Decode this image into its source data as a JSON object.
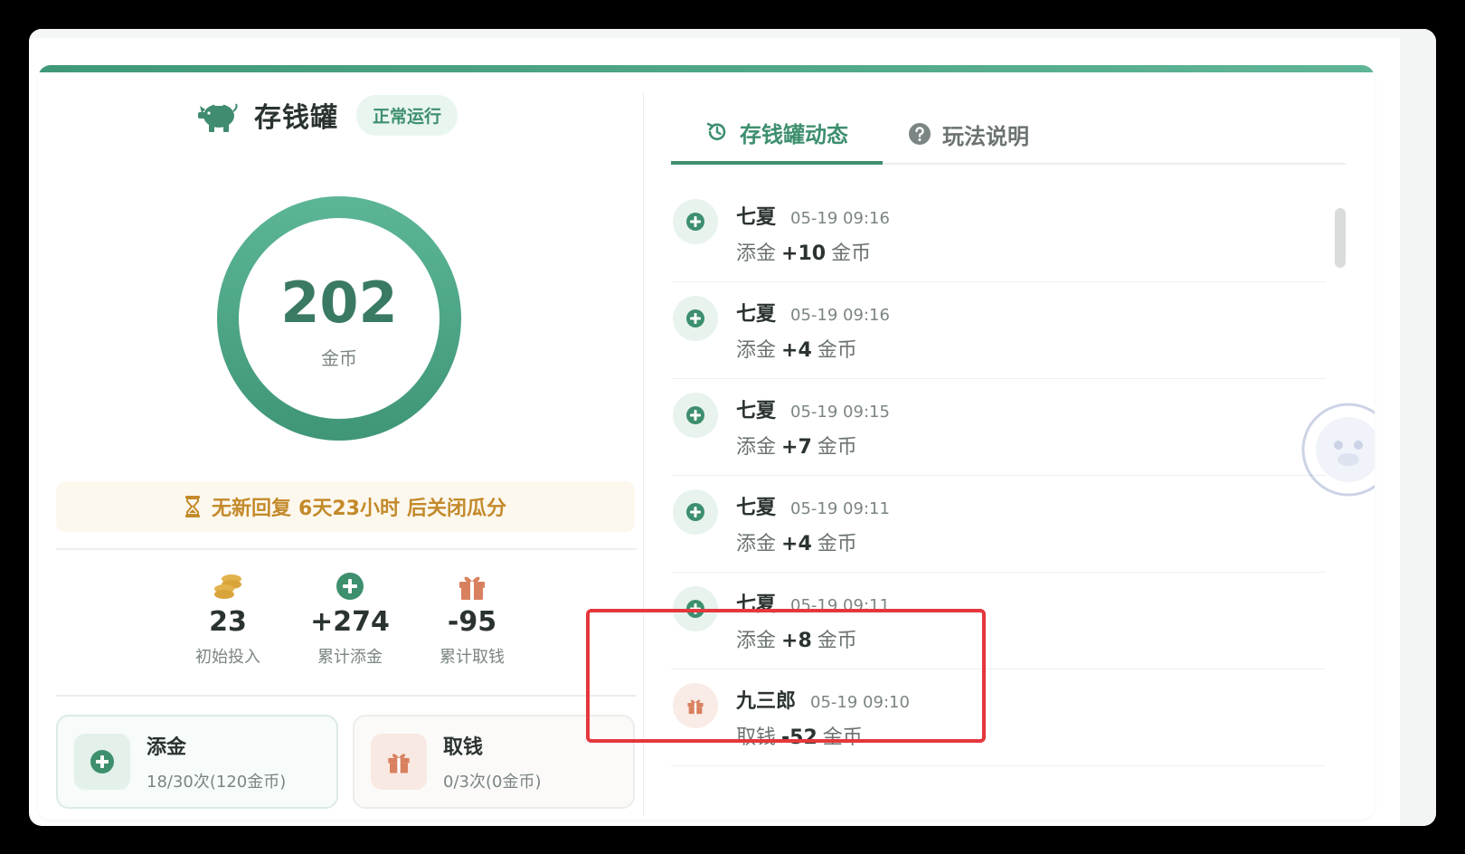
{
  "piggy": {
    "title": "存钱罐",
    "status": "正常运行",
    "balance": "202",
    "unit": "金币",
    "notice": {
      "prefix": "无新回复",
      "remaining": "6天23小时",
      "suffix": "后关闭瓜分"
    },
    "stats": [
      {
        "value": "23",
        "label": "初始投入",
        "icon": "coins-icon"
      },
      {
        "value": "+274",
        "label": "累计添金",
        "icon": "plus-circle-icon"
      },
      {
        "value": "-95",
        "label": "累计取钱",
        "icon": "gift-icon"
      }
    ],
    "actions": {
      "add": {
        "title": "添金",
        "sub": "18/30次(120金币)"
      },
      "take": {
        "title": "取钱",
        "sub": "0/3次(0金币)"
      }
    }
  },
  "tabs": {
    "activity": "存钱罐动态",
    "rules": "玩法说明"
  },
  "feed": [
    {
      "name": "七夏",
      "time": "05-19 09:16",
      "action": "添金",
      "amount": "+10",
      "unit": "金币",
      "type": "add"
    },
    {
      "name": "七夏",
      "time": "05-19 09:16",
      "action": "添金",
      "amount": "+4",
      "unit": "金币",
      "type": "add"
    },
    {
      "name": "七夏",
      "time": "05-19 09:15",
      "action": "添金",
      "amount": "+7",
      "unit": "金币",
      "type": "add"
    },
    {
      "name": "七夏",
      "time": "05-19 09:11",
      "action": "添金",
      "amount": "+4",
      "unit": "金币",
      "type": "add"
    },
    {
      "name": "七夏",
      "time": "05-19 09:11",
      "action": "添金",
      "amount": "+8",
      "unit": "金币",
      "type": "add"
    },
    {
      "name": "九三郎",
      "time": "05-19 09:10",
      "action": "取钱",
      "amount": "-52",
      "unit": "金币",
      "type": "take"
    }
  ],
  "colors": {
    "accent": "#3d8f6e",
    "gold": "#c38a2b",
    "gift": "#d9805f",
    "highlight": "#e5373d"
  }
}
